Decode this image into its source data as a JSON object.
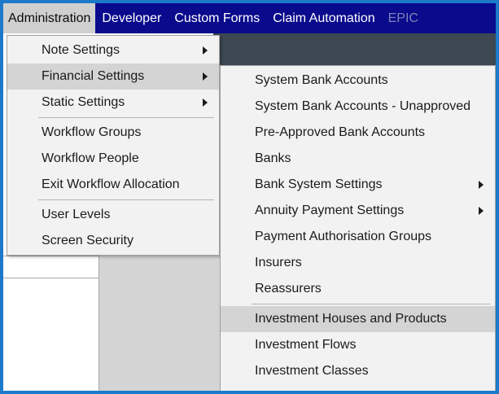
{
  "colors": {
    "frame_border": "#1c7ac9",
    "menubar_bg": "#0a0a8c",
    "menu_bg": "#f2f2f2",
    "highlight": "#d4d4d4"
  },
  "menubar": {
    "items": [
      {
        "label": "Administration",
        "state": "active"
      },
      {
        "label": "Developer",
        "state": "normal"
      },
      {
        "label": "Custom Forms",
        "state": "normal"
      },
      {
        "label": "Claim Automation",
        "state": "normal"
      },
      {
        "label": "EPIC",
        "state": "disabled"
      }
    ]
  },
  "admin_menu": {
    "items": [
      {
        "label": "Note Settings",
        "submenu": true
      },
      {
        "label": "Financial Settings",
        "submenu": true,
        "highlighted": true
      },
      {
        "label": "Static Settings",
        "submenu": true
      },
      {
        "label": "Workflow Groups"
      },
      {
        "label": "Workflow People"
      },
      {
        "label": "Exit Workflow Allocation"
      },
      {
        "label": "User Levels"
      },
      {
        "label": "Screen Security"
      }
    ]
  },
  "financial_menu": {
    "items": [
      {
        "label": "System Bank Accounts"
      },
      {
        "label": "System Bank Accounts - Unapproved"
      },
      {
        "label": "Pre-Approved Bank Accounts"
      },
      {
        "label": "Banks"
      },
      {
        "label": "Bank System Settings",
        "submenu": true
      },
      {
        "label": "Annuity Payment Settings",
        "submenu": true
      },
      {
        "label": "Payment Authorisation Groups"
      },
      {
        "label": "Insurers"
      },
      {
        "label": "Reassurers"
      },
      {
        "label": "Investment Houses and Products",
        "highlighted": true
      },
      {
        "label": "Investment Flows"
      },
      {
        "label": "Investment Classes"
      }
    ]
  }
}
